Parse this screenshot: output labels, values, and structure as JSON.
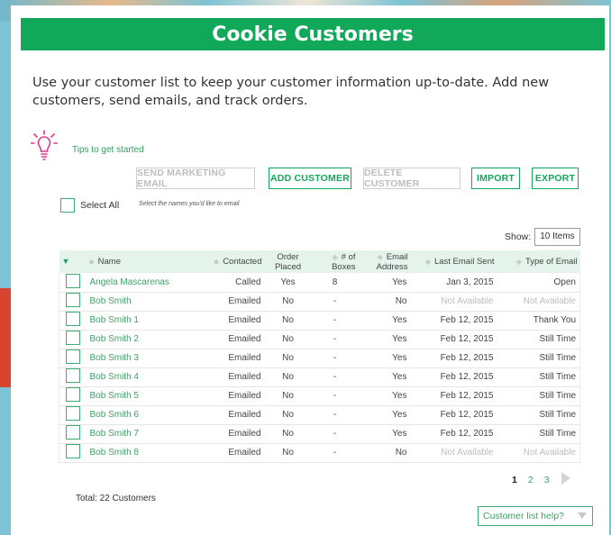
{
  "header": {
    "title": "Cookie Customers"
  },
  "intro": {
    "text": "Use your customer list to keep your customer information up-to-date. Add new customers, send emails, and track orders."
  },
  "tips": {
    "label": "Tips to get started",
    "icon": "lightbulb-icon"
  },
  "actions": {
    "send_marketing_email": "SEND MARKETING EMAIL",
    "add_customer": "ADD CUSTOMER",
    "delete_customer": "DELETE CUSTOMER",
    "import": "IMPORT",
    "export": "EXPORT"
  },
  "selection": {
    "select_all_label": "Select All",
    "hint": "Select the names you'd like to email"
  },
  "show": {
    "label": "Show:",
    "value": "10 Items"
  },
  "table": {
    "columns": [
      "Name",
      "Contacted",
      "Order Placed",
      "# of Boxes",
      "Email Address",
      "Last Email Sent",
      "Type of Email"
    ],
    "rows": [
      [
        "Angela Mascarenas",
        "Called",
        "Yes",
        "8",
        "Yes",
        "Jan 3, 2015",
        "Open"
      ],
      [
        "Bob Smith",
        "Emailed",
        "No",
        "-",
        "No",
        "Not Available",
        "Not Available"
      ],
      [
        "Bob Smith 1",
        "Emailed",
        "No",
        "-",
        "Yes",
        "Feb 12, 2015",
        "Thank You"
      ],
      [
        "Bob Smith 2",
        "Emailed",
        "No",
        "-",
        "Yes",
        "Feb 12, 2015",
        "Still Time"
      ],
      [
        "Bob Smith 3",
        "Emailed",
        "No",
        "-",
        "Yes",
        "Feb 12, 2015",
        "Still Time"
      ],
      [
        "Bob Smith 4",
        "Emailed",
        "No",
        "-",
        "Yes",
        "Feb 12, 2015",
        "Still Time"
      ],
      [
        "Bob Smith 5",
        "Emailed",
        "No",
        "-",
        "Yes",
        "Feb 12, 2015",
        "Still Time"
      ],
      [
        "Bob Smith 6",
        "Emailed",
        "No",
        "-",
        "Yes",
        "Feb 12, 2015",
        "Still Time"
      ],
      [
        "Bob Smith 7",
        "Emailed",
        "No",
        "-",
        "Yes",
        "Feb 12, 2015",
        "Still Time"
      ],
      [
        "Bob Smith 8",
        "Emailed",
        "No",
        "-",
        "No",
        "Not Available",
        "Not Available"
      ]
    ]
  },
  "pagination": {
    "pages": [
      "1",
      "2",
      "3"
    ],
    "current": "1"
  },
  "footer": {
    "total": "Total: 22 Customers",
    "help": "Customer list help?"
  },
  "colors": {
    "brand_green": "#12a85a",
    "link_green": "#3fa068",
    "header_row": "#e4f4ea",
    "tips_icon": "#e0368f"
  }
}
